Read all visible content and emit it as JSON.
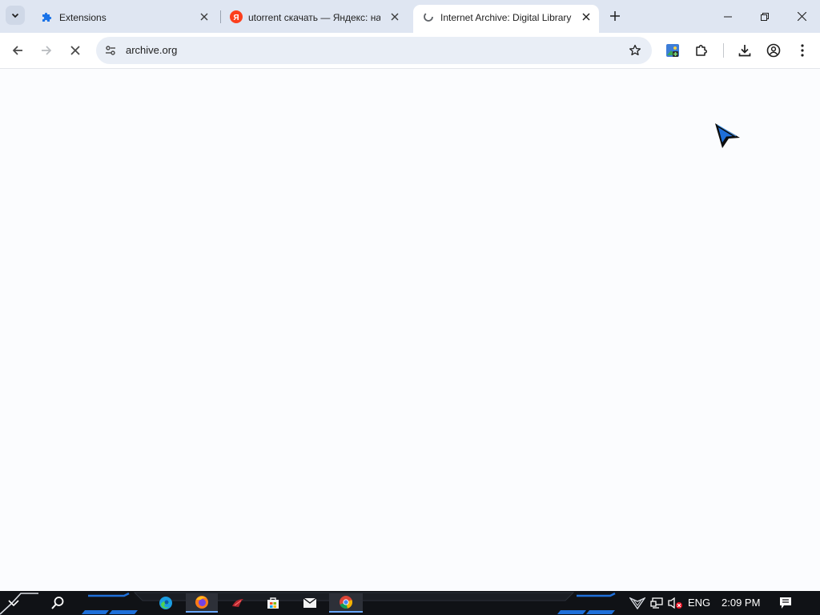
{
  "browser": {
    "tabs": [
      {
        "title": "Extensions",
        "favicon": "puzzle-icon",
        "active": false
      },
      {
        "title": "utorrent скачать — Яндекс: на",
        "favicon": "yandex-icon",
        "active": false
      },
      {
        "title": "Internet Archive: Digital Library",
        "favicon": "loading-icon",
        "active": true
      }
    ],
    "omnibox": {
      "url": "archive.org"
    },
    "loading": true
  },
  "taskbar": {
    "language": "ENG",
    "time": "2:09 PM",
    "pinned_apps": [
      "edge-icon",
      "firefox-icon",
      "game-icon",
      "store-icon",
      "mail-icon",
      "chrome-icon"
    ]
  },
  "colors": {
    "tabstrip": "#dfe6f2",
    "omnibox": "#e9eef6",
    "taskbar": "#101216",
    "accent_blue": "#1a73e8",
    "yandex_red": "#fc3f1d"
  }
}
